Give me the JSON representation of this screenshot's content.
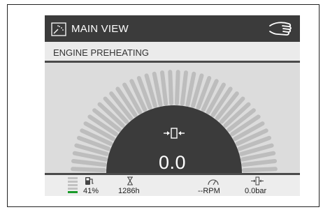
{
  "header": {
    "title": "MAIN VIEW",
    "title_icon": "main-view-icon",
    "right_icon": "touch-hand-icon"
  },
  "status": {
    "text": "ENGINE PREHEATING"
  },
  "gauge": {
    "value": "0.0",
    "icon": "actuator-icon"
  },
  "bottom": {
    "fuel": {
      "value": "41%",
      "level": 0.41
    },
    "hours": {
      "value": "1286h"
    },
    "rpm": {
      "value": "--RPM"
    },
    "pressure": {
      "value": "0.0bar"
    }
  },
  "colors": {
    "header_bg": "#3b3b3b",
    "fuel_ok": "#1a9a2a"
  }
}
